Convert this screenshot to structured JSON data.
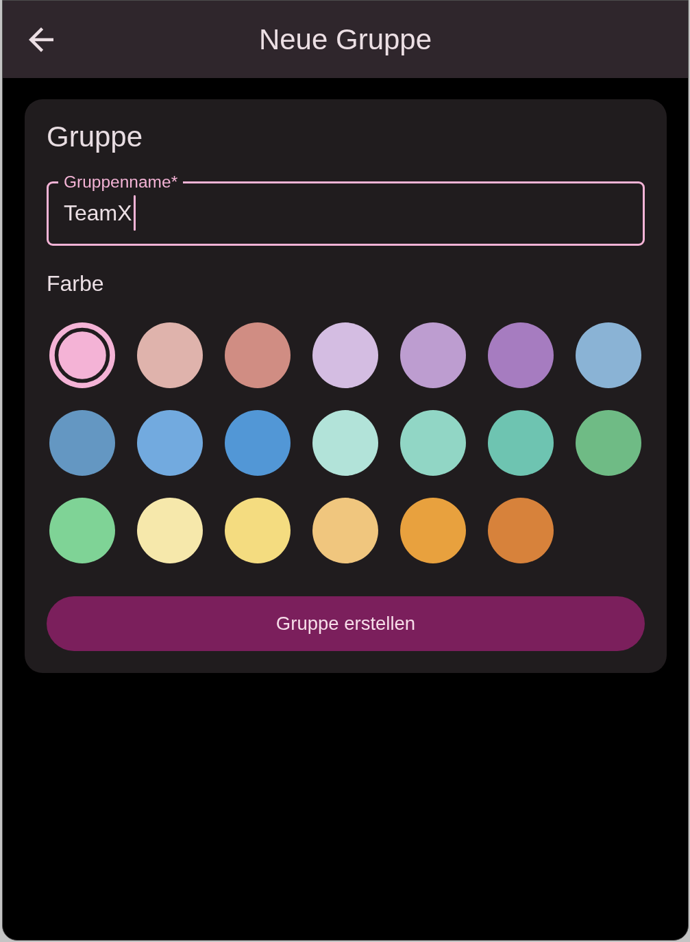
{
  "app_bar": {
    "title": "Neue Gruppe"
  },
  "card": {
    "title": "Gruppe",
    "name_field": {
      "label": "Gruppenname*",
      "value": "TeamX",
      "focused": true
    },
    "color_label": "Farbe",
    "colors": [
      {
        "color": "#f4b3d6",
        "selected": true
      },
      {
        "color": "#dfb3ac",
        "selected": false
      },
      {
        "color": "#d08d83",
        "selected": false
      },
      {
        "color": "#d4bde2",
        "selected": false
      },
      {
        "color": "#bd9dd0",
        "selected": false
      },
      {
        "color": "#a67cc0",
        "selected": false
      },
      {
        "color": "#8ab3d5",
        "selected": false
      },
      {
        "color": "#6497c2",
        "selected": false
      },
      {
        "color": "#72aadf",
        "selected": false
      },
      {
        "color": "#5297d6",
        "selected": false
      },
      {
        "color": "#b2e3d9",
        "selected": false
      },
      {
        "color": "#91d6c5",
        "selected": false
      },
      {
        "color": "#6ec4b1",
        "selected": false
      },
      {
        "color": "#6fbb85",
        "selected": false
      },
      {
        "color": "#7fd396",
        "selected": false
      },
      {
        "color": "#f6e8ab",
        "selected": false
      },
      {
        "color": "#f4dc80",
        "selected": false
      },
      {
        "color": "#f0c67e",
        "selected": false
      },
      {
        "color": "#e8a13e",
        "selected": false
      },
      {
        "color": "#d7823b",
        "selected": false
      }
    ],
    "submit_button": "Gruppe erstellen"
  }
}
